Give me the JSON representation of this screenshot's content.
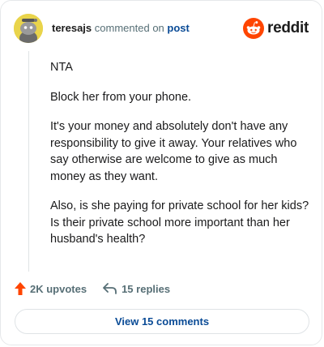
{
  "header": {
    "username": "teresajs",
    "commented_text": "commented on",
    "post_link": "post",
    "brand": "reddit"
  },
  "comment": {
    "paragraphs": [
      "NTA",
      "Block her from your phone.",
      "It's your money and absolutely don't have any responsibility to give it away. Your relatives who say otherwise are welcome to give as much money as they want.",
      "Also, is she paying for private school for her kids? Is their private school more important than her husband's health?"
    ]
  },
  "actions": {
    "upvotes": "2K upvotes",
    "replies": "15 replies"
  },
  "footer": {
    "view_comments": "View 15 comments"
  },
  "colors": {
    "brand_orange": "#ff4500",
    "link_blue": "#0a4b96",
    "avatar_yellow": "#e9d44b"
  }
}
